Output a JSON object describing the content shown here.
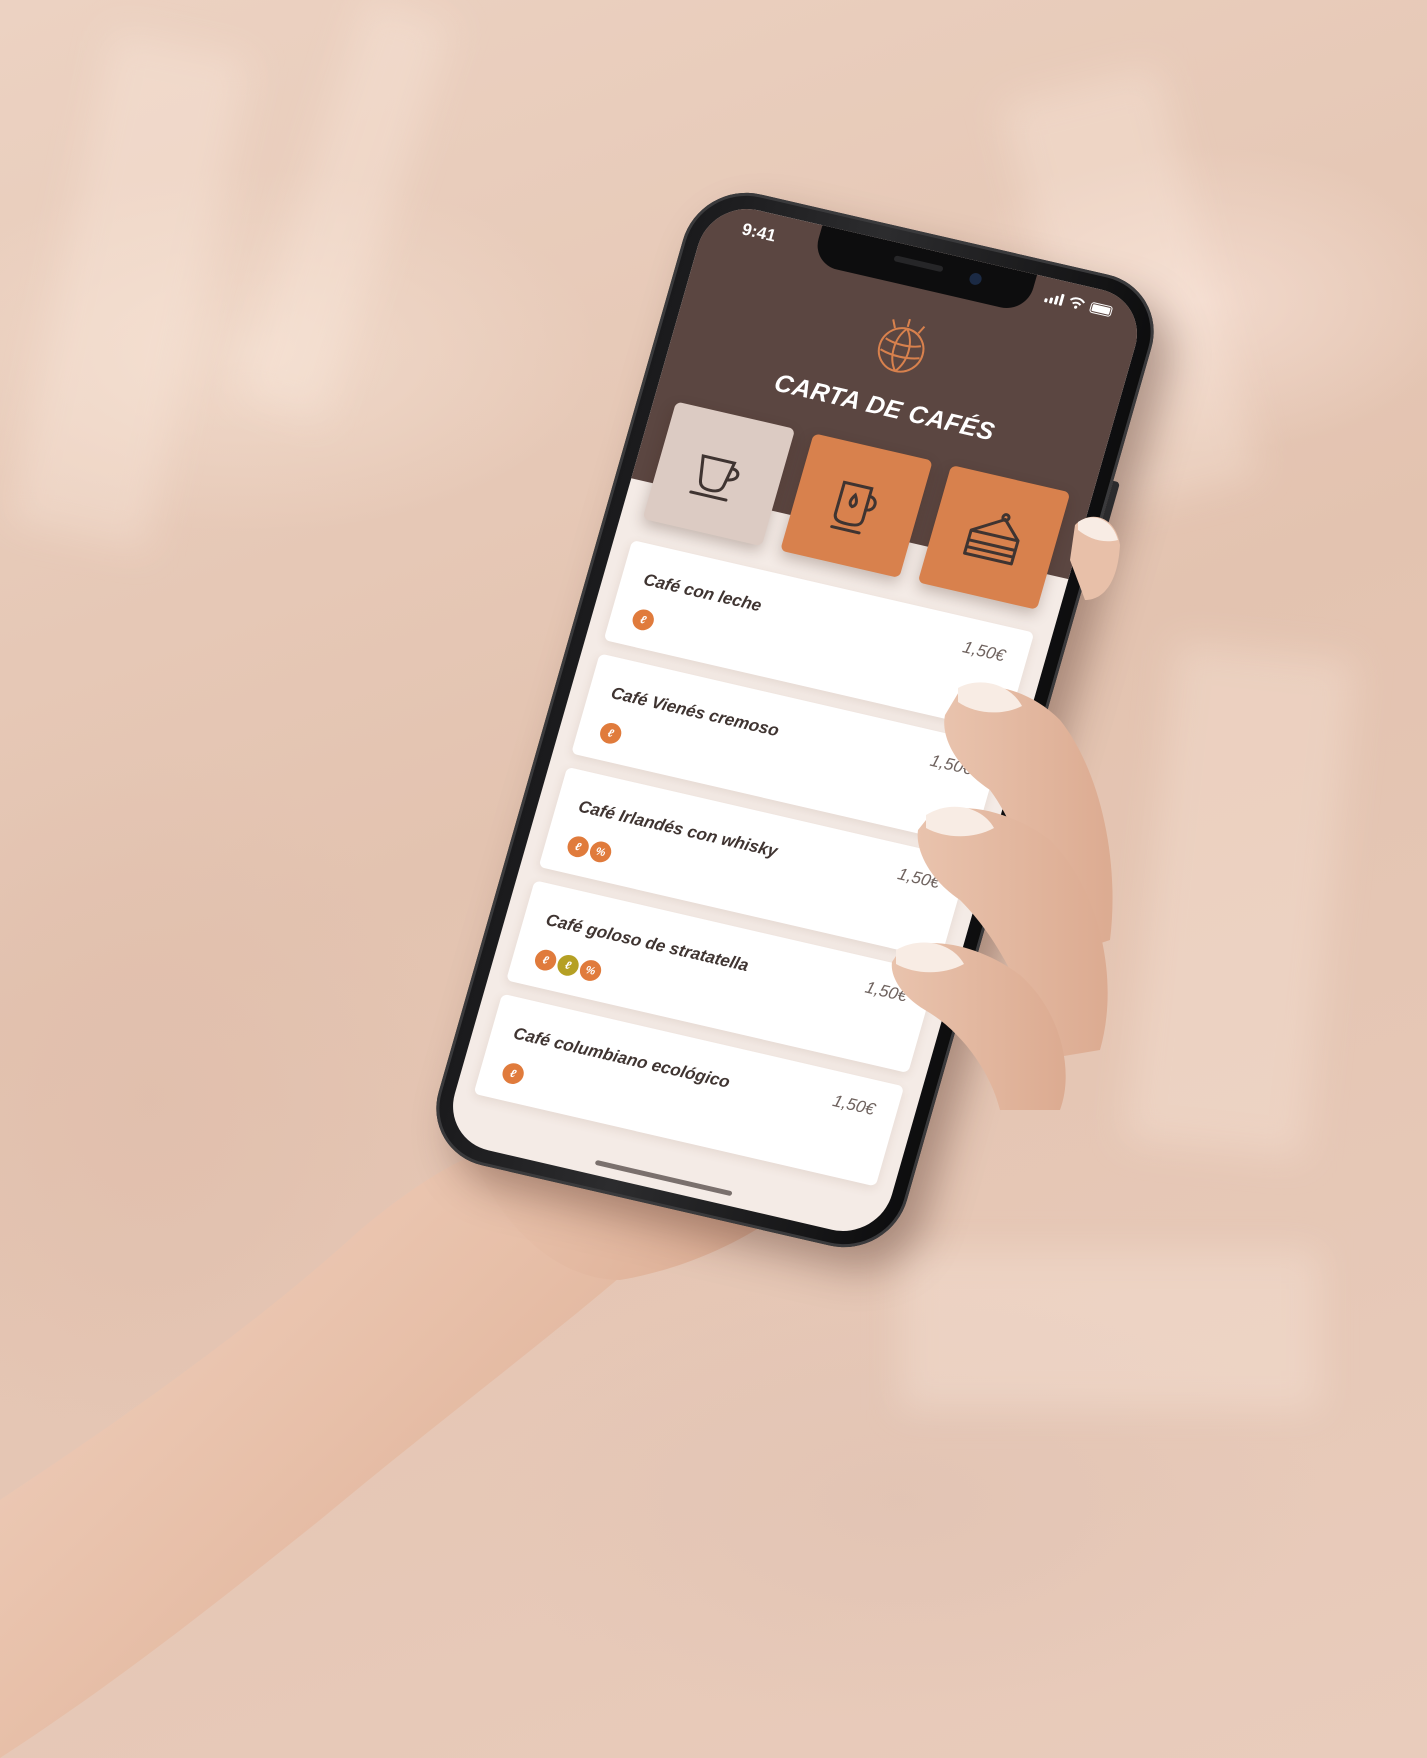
{
  "status_bar": {
    "time": "9:41",
    "signal_icon": "cellular-signal-icon",
    "wifi_icon": "wifi-icon",
    "battery_icon": "battery-icon"
  },
  "header": {
    "logo_icon": "coffee-bean-logo-icon",
    "title": "CARTA DE CAFÉS"
  },
  "tabs": [
    {
      "icon": "coffee-cup-icon",
      "active": true
    },
    {
      "icon": "coffee-mug-drop-icon",
      "active": false
    },
    {
      "icon": "cake-slice-icon",
      "active": false
    }
  ],
  "items": [
    {
      "name": "Café con leche",
      "price": "1,50€",
      "tags": [
        "coffee"
      ]
    },
    {
      "name": "Café Vienés cremoso",
      "price": "1,50€",
      "tags": [
        "coffee"
      ]
    },
    {
      "name": "Café Irlandés con whisky",
      "price": "1,50€",
      "tags": [
        "coffee",
        "alcohol"
      ]
    },
    {
      "name": "Café goloso de stratatella",
      "price": "1,50€",
      "tags": [
        "coffee",
        "nuts",
        "alcohol"
      ]
    },
    {
      "name": "Café columbiano ecológico",
      "price": "1,50€",
      "tags": [
        "coffee"
      ]
    }
  ],
  "colors": {
    "header": "#5b4641",
    "accent": "#d8814d",
    "active_tab": "#dccbc3",
    "screen_bg": "#f4ebe6",
    "background": "#e8cbbb"
  }
}
